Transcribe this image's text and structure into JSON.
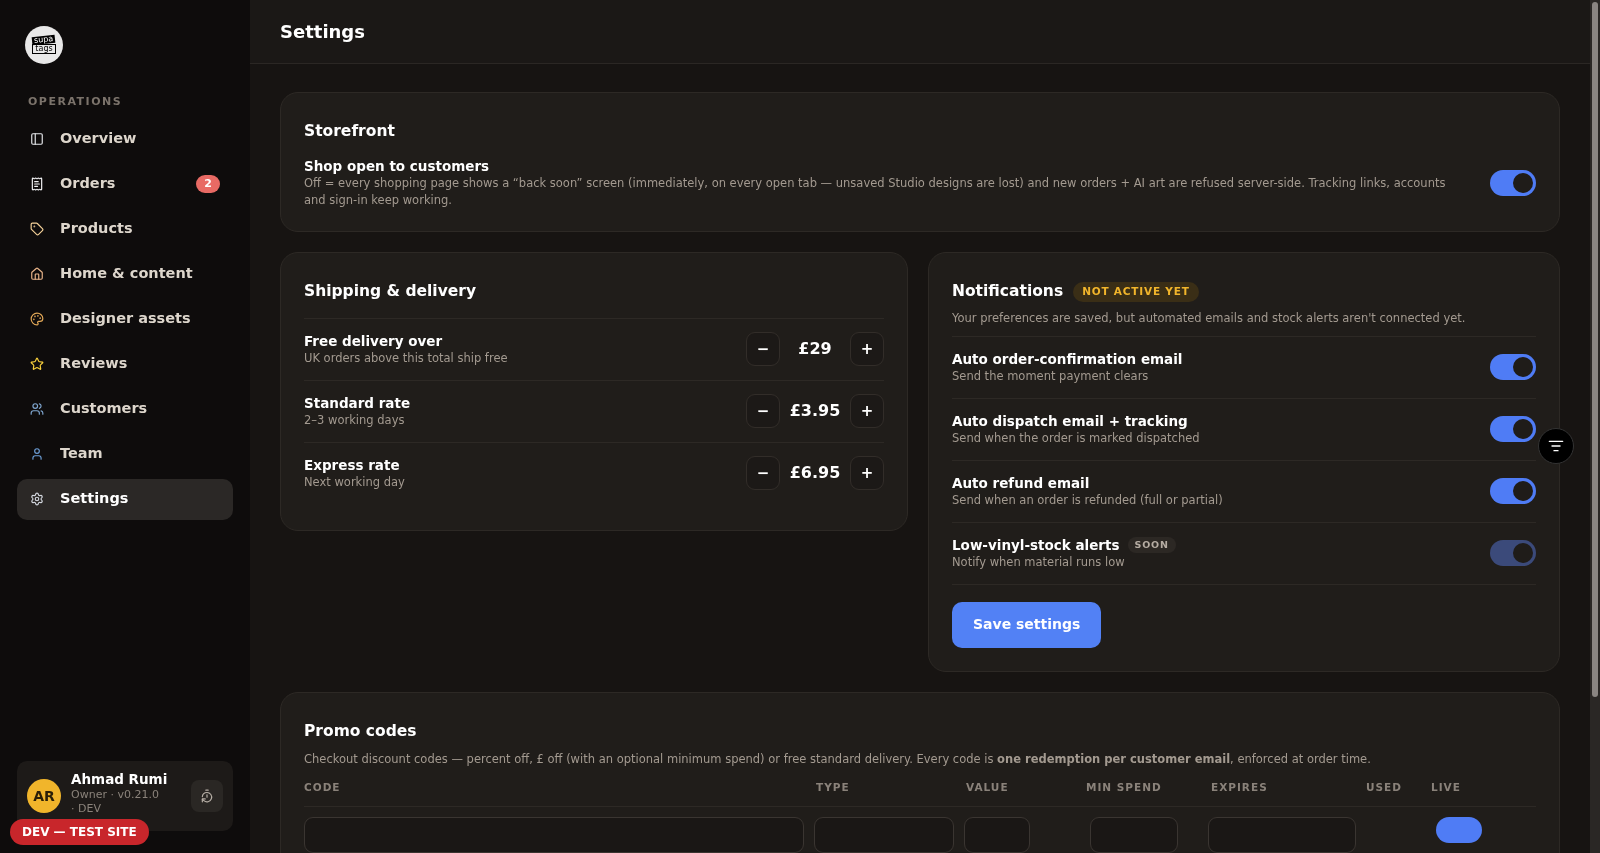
{
  "brand": {
    "logo_top": "supa",
    "logo_bottom": "tags"
  },
  "sidebar": {
    "section": "OPERATIONS",
    "items": [
      {
        "label": "Overview",
        "selected": false
      },
      {
        "label": "Orders",
        "badge": "2",
        "selected": false
      },
      {
        "label": "Products",
        "selected": false
      },
      {
        "label": "Home & content",
        "selected": false
      },
      {
        "label": "Designer assets",
        "selected": false
      },
      {
        "label": "Reviews",
        "selected": false
      },
      {
        "label": "Customers",
        "selected": false
      },
      {
        "label": "Team",
        "selected": false
      },
      {
        "label": "Settings",
        "selected": true
      }
    ]
  },
  "user": {
    "initials": "AR",
    "name": "Ahmad Rumi",
    "role": "Owner · v0.21.0 · DEV"
  },
  "env_badge": "DEV — TEST SITE",
  "header": {
    "title": "Settings"
  },
  "storefront": {
    "title": "Storefront",
    "setting": {
      "label": "Shop open to customers",
      "description": "Off = every shopping page shows a “back soon” screen (immediately, on every open tab — unsaved Studio designs are lost) and new orders + AI art are refused server-side. Tracking links, accounts and sign-in keep working.",
      "on": true
    }
  },
  "shipping": {
    "title": "Shipping & delivery",
    "rows": [
      {
        "label": "Free delivery over",
        "description": "UK orders above this total ship free",
        "value": "£29",
        "minus": "−",
        "plus": "+"
      },
      {
        "label": "Standard rate",
        "description": "2–3 working days",
        "value": "£3.95",
        "minus": "−",
        "plus": "+"
      },
      {
        "label": "Express rate",
        "description": "Next working day",
        "value": "£6.95",
        "minus": "−",
        "plus": "+"
      }
    ]
  },
  "notifications": {
    "title": "Notifications",
    "badge": "NOT ACTIVE YET",
    "description": "Your preferences are saved, but automated emails and stock alerts aren't connected yet.",
    "items": [
      {
        "label": "Auto order-confirmation email",
        "description": "Send the moment payment clears",
        "on": true,
        "disabled": false
      },
      {
        "label": "Auto dispatch email + tracking",
        "description": "Send when the order is marked dispatched",
        "on": true,
        "disabled": false
      },
      {
        "label": "Auto refund email",
        "description": "Send when an order is refunded (full or partial)",
        "on": true,
        "disabled": false
      },
      {
        "label": "Low-vinyl-stock alerts",
        "tag": "SOON",
        "description": "Notify when material runs low",
        "on": true,
        "disabled": true
      }
    ],
    "save_button": "Save settings"
  },
  "promo": {
    "title": "Promo codes",
    "description": "Checkout discount codes — percent off, £ off (with an optional minimum spend) or free standard delivery. Every code is **one redemption per customer email**, enforced at order time.",
    "columns": [
      "CODE",
      "TYPE",
      "VALUE",
      "MIN SPEND",
      "EXPIRES",
      "USED",
      "LIVE"
    ],
    "rows": [
      {
        "live": true
      }
    ]
  }
}
